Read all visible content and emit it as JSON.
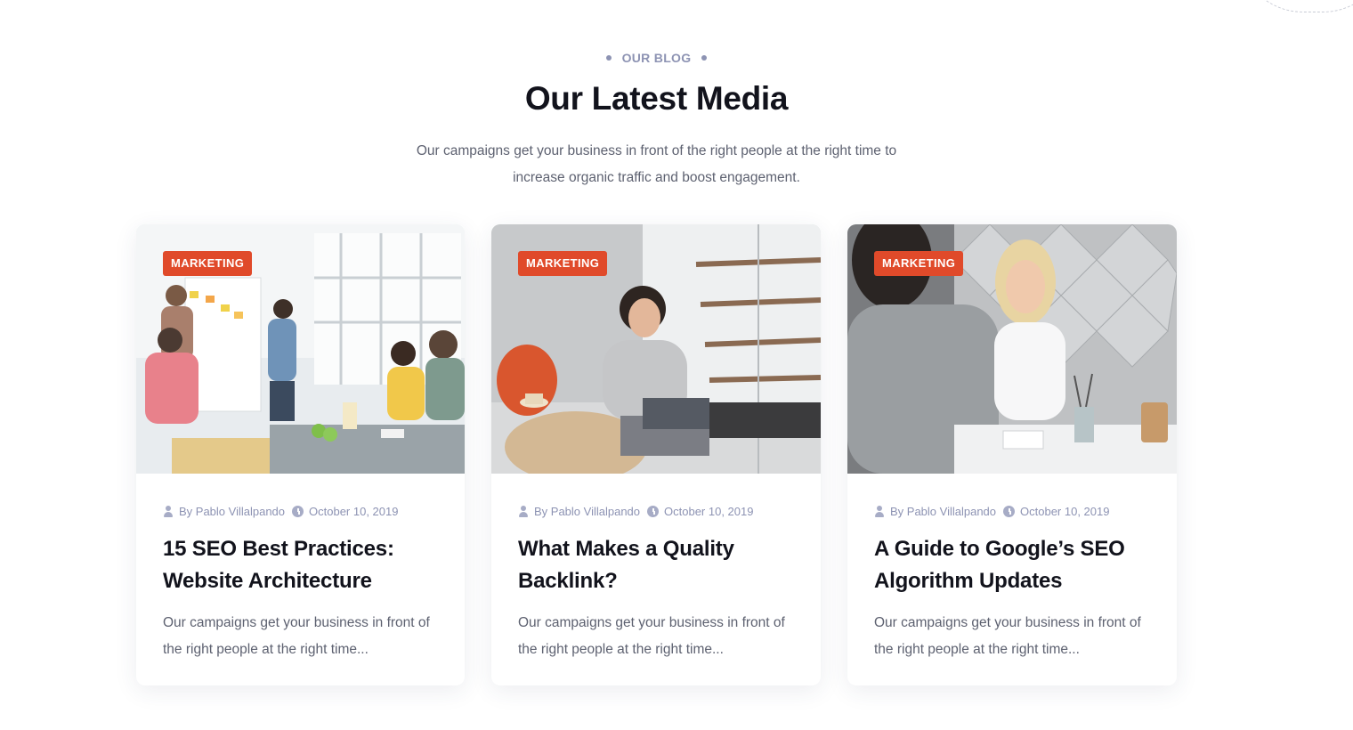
{
  "section": {
    "eyebrow": "OUR BLOG",
    "heading": "Our Latest Media",
    "subtext": "Our campaigns get your business in front of the right people at the right time to increase organic traffic and boost engagement."
  },
  "posts": [
    {
      "category": "MARKETING",
      "author": "By Pablo Villalpando",
      "date": "October 10, 2019",
      "title": "15 SEO Best Practices: Website Architecture",
      "excerpt": "Our campaigns get your business in front of the right people at the right time..."
    },
    {
      "category": "MARKETING",
      "author": "By Pablo Villalpando",
      "date": "October 10, 2019",
      "title": "What Makes a Quality Backlink?",
      "excerpt": "Our campaigns get your business in front of the right people at the right time..."
    },
    {
      "category": "MARKETING",
      "author": "By Pablo Villalpando",
      "date": "October 10, 2019",
      "title": "A Guide to Google’s SEO Algorithm Updates",
      "excerpt": "Our campaigns get your business in front of the right people at the right time..."
    }
  ],
  "colors": {
    "badge": "#e04a2a",
    "meta": "#8d93b3",
    "heading": "#12131c",
    "body_text": "#5d6170"
  }
}
